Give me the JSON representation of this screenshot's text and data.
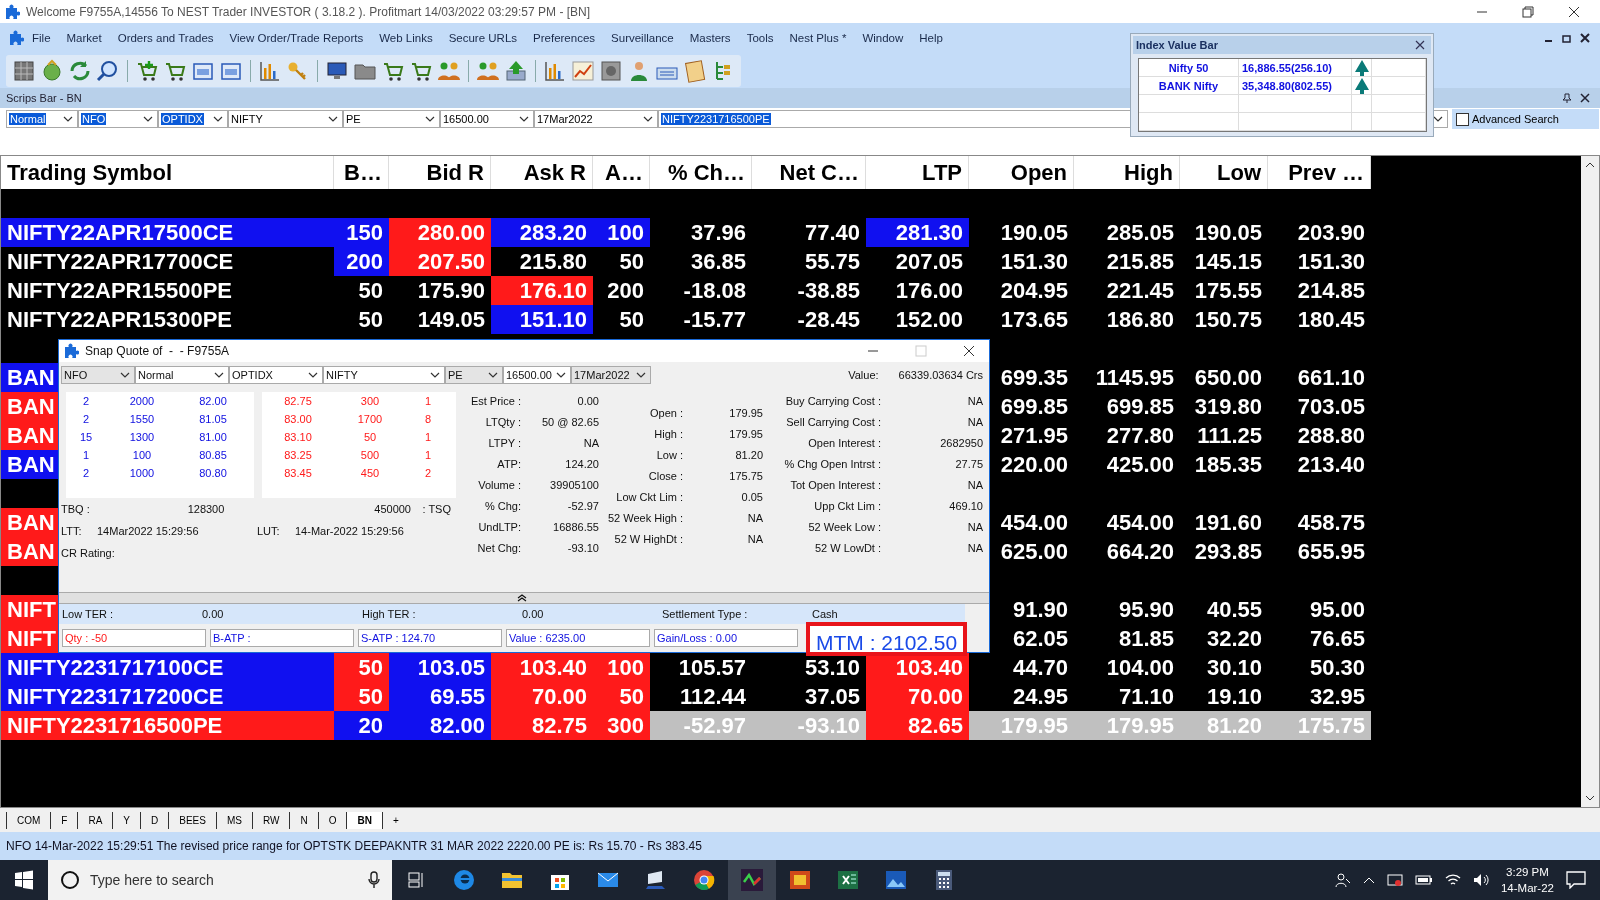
{
  "window": {
    "title": "Welcome F9755A,14556 To NEST Trader INVESTOR ( 3.18.2 ).  Profitmart  14/03/2022  03:29:57 PM - [BN]"
  },
  "menu": [
    "File",
    "Market",
    "Orders and Trades",
    "View Order/Trade Reports",
    "Web Links",
    "Secure URLs",
    "Preferences",
    "Surveillance",
    "Masters",
    "Tools",
    "Nest Plus *",
    "Window",
    "Help"
  ],
  "scrips_bar": {
    "title": "Scrips Bar - BN",
    "fields": [
      {
        "value": "Normal",
        "highlighted": true
      },
      {
        "value": "NFO",
        "highlighted": true
      },
      {
        "value": "OPTIDX",
        "highlighted": true
      },
      {
        "value": "NIFTY",
        "highlighted": false
      },
      {
        "value": "PE",
        "highlighted": false
      },
      {
        "value": "16500.00",
        "highlighted": false
      },
      {
        "value": "17Mar2022",
        "highlighted": false
      }
    ],
    "symbol": {
      "value": "NIFTY2231716500PE",
      "highlighted": true
    },
    "advanced_search": {
      "label": "Advanced Search",
      "checked": false
    }
  },
  "index_value_bar": {
    "title": "Index Value Bar",
    "rows": [
      {
        "name": "Nifty 50",
        "value": "16,886.55(256.10)",
        "rising": true
      },
      {
        "name": "BANK Nifty",
        "value": "35,348.80(802.55)",
        "rising": true
      }
    ]
  },
  "market_watch": {
    "columns": [
      "Trading Symbol",
      "B…",
      "Bid R",
      "Ask R",
      "A…",
      "% Ch…",
      "Net C…",
      "LTP",
      "Open",
      "High",
      "Low",
      "Prev …"
    ],
    "rows": [
      {
        "kind": "blank",
        "selected": false
      },
      {
        "kind": "quote",
        "selected": false,
        "symbol": {
          "text": "NIFTY22APR17500CE",
          "color": "#1010f0"
        },
        "cells": [
          {
            "text": "150",
            "color": "#1010f0"
          },
          {
            "text": "280.00",
            "color": "#ff1a1a"
          },
          {
            "text": "283.20",
            "color": "#1010f0"
          },
          {
            "text": "100",
            "color": "#1010f0"
          },
          {
            "text": "37.96"
          },
          {
            "text": "77.40"
          },
          {
            "text": "281.30",
            "color": "#1010f0"
          },
          {
            "text": "190.05"
          },
          {
            "text": "285.05"
          },
          {
            "text": "190.05"
          },
          {
            "text": "203.90"
          }
        ]
      },
      {
        "kind": "quote",
        "selected": false,
        "symbol": {
          "text": "NIFTY22APR17700CE"
        },
        "cells": [
          {
            "text": "200",
            "color": "#1010f0"
          },
          {
            "text": "207.50",
            "color": "#ff1a1a"
          },
          {
            "text": "215.80"
          },
          {
            "text": "50"
          },
          {
            "text": "36.85"
          },
          {
            "text": "55.75"
          },
          {
            "text": "207.05"
          },
          {
            "text": "151.30"
          },
          {
            "text": "215.85"
          },
          {
            "text": "145.15"
          },
          {
            "text": "151.30"
          }
        ]
      },
      {
        "kind": "quote",
        "selected": false,
        "symbol": {
          "text": "NIFTY22APR15500PE"
        },
        "cells": [
          {
            "text": "50"
          },
          {
            "text": "175.90"
          },
          {
            "text": "176.10",
            "color": "#ff1a1a"
          },
          {
            "text": "200"
          },
          {
            "text": "-18.08"
          },
          {
            "text": "-38.85"
          },
          {
            "text": "176.00"
          },
          {
            "text": "204.95"
          },
          {
            "text": "221.45"
          },
          {
            "text": "175.55"
          },
          {
            "text": "214.85"
          }
        ]
      },
      {
        "kind": "quote",
        "selected": false,
        "symbol": {
          "text": "NIFTY22APR15300PE"
        },
        "cells": [
          {
            "text": "50"
          },
          {
            "text": "149.05"
          },
          {
            "text": "151.10",
            "color": "#1010f0"
          },
          {
            "text": "50"
          },
          {
            "text": "-15.77"
          },
          {
            "text": "-28.45"
          },
          {
            "text": "152.00"
          },
          {
            "text": "173.65"
          },
          {
            "text": "186.80"
          },
          {
            "text": "150.75"
          },
          {
            "text": "180.45"
          }
        ]
      },
      {
        "kind": "blank",
        "selected": false
      },
      {
        "kind": "quote",
        "selected": false,
        "symbol": {
          "text": "BAN",
          "color": "#1010f0"
        },
        "cells": [
          {
            "text": "699.35"
          },
          {
            "text": "1145.95"
          },
          {
            "text": "650.00"
          },
          {
            "text": "661.10"
          }
        ]
      },
      {
        "kind": "quote",
        "selected": false,
        "symbol": {
          "text": "BAN",
          "color": "#ff1a1a"
        },
        "cells": [
          {
            "text": "699.85"
          },
          {
            "text": "699.85"
          },
          {
            "text": "319.80"
          },
          {
            "text": "703.05"
          }
        ]
      },
      {
        "kind": "quote",
        "selected": false,
        "symbol": {
          "text": "BAN",
          "color": "#ff1a1a"
        },
        "cells": [
          {
            "text": "271.95"
          },
          {
            "text": "277.80"
          },
          {
            "text": "111.25"
          },
          {
            "text": "288.80"
          }
        ]
      },
      {
        "kind": "quote",
        "selected": false,
        "symbol": {
          "text": "BAN",
          "color": "#1010f0"
        },
        "cells": [
          {
            "text": "220.00"
          },
          {
            "text": "425.00"
          },
          {
            "text": "185.35"
          },
          {
            "text": "213.40"
          }
        ]
      },
      {
        "kind": "blank",
        "selected": false
      },
      {
        "kind": "quote",
        "selected": false,
        "symbol": {
          "text": "BAN",
          "color": "#ff1a1a"
        },
        "cells": [
          {
            "text": "454.00"
          },
          {
            "text": "454.00"
          },
          {
            "text": "191.60"
          },
          {
            "text": "458.75"
          }
        ]
      },
      {
        "kind": "quote",
        "selected": false,
        "symbol": {
          "text": "BAN",
          "color": "#ff1a1a"
        },
        "cells": [
          {
            "text": "625.00"
          },
          {
            "text": "664.20"
          },
          {
            "text": "293.85"
          },
          {
            "text": "655.95"
          }
        ]
      },
      {
        "kind": "blank",
        "selected": false
      },
      {
        "kind": "quote",
        "selected": false,
        "symbol": {
          "text": "NIFT",
          "color": "#ff1a1a"
        },
        "cells": [
          {
            "text": "91.90"
          },
          {
            "text": "95.90"
          },
          {
            "text": "40.55"
          },
          {
            "text": "95.00"
          }
        ]
      },
      {
        "kind": "quote",
        "selected": false,
        "symbol": {
          "text": "NIFT",
          "color": "#ff1a1a"
        },
        "cells": [
          {
            "text": "62.05"
          },
          {
            "text": "81.85"
          },
          {
            "text": "32.20"
          },
          {
            "text": "76.65"
          }
        ]
      },
      {
        "kind": "quote",
        "selected": false,
        "symbol": {
          "text": "NIFTY2231717100CE",
          "color": "#1010f0"
        },
        "cells": [
          {
            "text": "50",
            "color": "#ff1a1a"
          },
          {
            "text": "103.05",
            "color": "#1010f0"
          },
          {
            "text": "103.40",
            "color": "#ff1a1a"
          },
          {
            "text": "100",
            "color": "#ff1a1a"
          },
          {
            "text": "105.57"
          },
          {
            "text": "53.10"
          },
          {
            "text": "103.40",
            "color": "#ff1a1a"
          },
          {
            "text": "44.70"
          },
          {
            "text": "104.00"
          },
          {
            "text": "30.10"
          },
          {
            "text": "50.30"
          }
        ]
      },
      {
        "kind": "quote",
        "selected": false,
        "symbol": {
          "text": "NIFTY2231717200CE",
          "color": "#1010f0"
        },
        "cells": [
          {
            "text": "50",
            "color": "#ff1a1a"
          },
          {
            "text": "69.55",
            "color": "#1010f0"
          },
          {
            "text": "70.00",
            "color": "#ff1a1a"
          },
          {
            "text": "50",
            "color": "#ff1a1a"
          },
          {
            "text": "112.44"
          },
          {
            "text": "37.05"
          },
          {
            "text": "70.00",
            "color": "#ff1a1a"
          },
          {
            "text": "24.95"
          },
          {
            "text": "71.10"
          },
          {
            "text": "19.10"
          },
          {
            "text": "32.95"
          }
        ]
      },
      {
        "kind": "quote",
        "selected": true,
        "symbol": {
          "text": "NIFTY2231716500PE",
          "color": "#ff1a1a"
        },
        "cells": [
          {
            "text": "20",
            "color": "#1010f0"
          },
          {
            "text": "82.00",
            "color": "#1010f0"
          },
          {
            "text": "82.75",
            "color": "#ff1a1a"
          },
          {
            "text": "300",
            "color": "#ff1a1a"
          },
          {
            "text": "-52.97"
          },
          {
            "text": "-93.10"
          },
          {
            "text": "82.65",
            "color": "#ff1a1a"
          },
          {
            "text": "179.95"
          },
          {
            "text": "179.95"
          },
          {
            "text": "81.20"
          },
          {
            "text": "175.75"
          }
        ]
      }
    ]
  },
  "snap_quote": {
    "title": "Snap Quote of  -  - F9755A",
    "selectors": [
      "NFO",
      "Normal",
      "OPTIDX",
      "NIFTY",
      "PE",
      "16500.00",
      "17Mar2022"
    ],
    "value": {
      "label": "Value:",
      "value": "66339.03634 Crs"
    },
    "bids": [
      [
        "2",
        "2000",
        "82.00"
      ],
      [
        "2",
        "1550",
        "81.05"
      ],
      [
        "15",
        "1300",
        "81.00"
      ],
      [
        "1",
        "100",
        "80.85"
      ],
      [
        "2",
        "1000",
        "80.80"
      ]
    ],
    "asks": [
      [
        "82.75",
        "300",
        "1"
      ],
      [
        "83.00",
        "1700",
        "8"
      ],
      [
        "83.10",
        "50",
        "1"
      ],
      [
        "83.25",
        "500",
        "1"
      ],
      [
        "83.45",
        "450",
        "2"
      ]
    ],
    "tbq": {
      "label": "TBQ :",
      "value": "128300"
    },
    "tsq": {
      "label": ": TSQ",
      "value": "450000"
    },
    "ltt": {
      "label": "LTT:",
      "value": "14Mar2022 15:29:56"
    },
    "lut": {
      "label": "LUT:",
      "value": "14-Mar-2022 15:29:56"
    },
    "cr_rating": "CR Rating:",
    "details": [
      [
        {
          "label": "Est Price :",
          "value": "0.00"
        },
        {
          "label": "LTQty :",
          "value": "50 @ 82.65"
        },
        {
          "label": "LTPY :",
          "value": "NA"
        },
        {
          "label": "ATP:",
          "value": "124.20"
        },
        {
          "label": "Volume :",
          "value": "39905100"
        },
        {
          "label": "% Chg:",
          "value": "-52.97"
        },
        {
          "label": "UndLTP:",
          "value": "16886.55"
        },
        {
          "label": "Net Chg:",
          "value": "-93.10"
        }
      ],
      [
        {
          "label": "Open :",
          "value": "179.95"
        },
        {
          "label": "High :",
          "value": "179.95"
        },
        {
          "label": "Low :",
          "value": "81.20"
        },
        {
          "label": "Close :",
          "value": "175.75"
        },
        {
          "label": "Low Ckt Lim :",
          "value": "0.05"
        },
        {
          "label": "52 Week High :",
          "value": "NA"
        },
        {
          "label": "52 W HighDt :",
          "value": "NA"
        }
      ],
      [
        {
          "label": "Buy Carrying Cost :",
          "value": "NA"
        },
        {
          "label": "Sell Carrying Cost :",
          "value": "NA"
        },
        {
          "label": "Open Interest :",
          "value": "2682950"
        },
        {
          "label": "% Chg Open Intrst :",
          "value": "27.75"
        },
        {
          "label": "Tot Open Interest :",
          "value": "NA"
        },
        {
          "label": "Upp Ckt Lim :",
          "value": "469.10"
        },
        {
          "label": "52 Week Low :",
          "value": "NA"
        },
        {
          "label": "52 W LowDt :",
          "value": "NA"
        }
      ]
    ],
    "ter_bar": [
      {
        "label": "Low TER :",
        "value": "0.00"
      },
      {
        "label": "High TER :",
        "value": "0.00"
      },
      {
        "label": "Settlement Type :",
        "value": "Cash"
      }
    ],
    "summary": [
      {
        "text": "Qty : -50",
        "kind": "alert"
      },
      {
        "text": "B-ATP :",
        "kind": "normal"
      },
      {
        "text": "S-ATP : 124.70",
        "kind": "normal"
      },
      {
        "text": "Value : 6235.00",
        "kind": "normal"
      },
      {
        "text": "Gain/Loss : 0.00",
        "kind": "normal"
      }
    ],
    "mtm": "MTM : 2102.50"
  },
  "sheet_tabs": [
    {
      "label": "COM",
      "selected": false
    },
    {
      "label": "F",
      "selected": false
    },
    {
      "label": "RA",
      "selected": false
    },
    {
      "label": "Y",
      "selected": false
    },
    {
      "label": "D",
      "selected": false
    },
    {
      "label": "BEES",
      "selected": false
    },
    {
      "label": "MS",
      "selected": false
    },
    {
      "label": "RW",
      "selected": false
    },
    {
      "label": "N",
      "selected": false
    },
    {
      "label": "O",
      "selected": false
    },
    {
      "label": "BN",
      "selected": true
    },
    {
      "label": "+",
      "selected": false
    }
  ],
  "status_bar": "NFO 14-Mar-2022 15:29:51 The revised price range for OPTSTK DEEPAKNTR 31 MAR 2022 2220.00 PE is: Rs 15.70 - Rs 383.45",
  "taskbar": {
    "search_placeholder": "Type here to search",
    "time": "3:29 PM",
    "date": "14-Mar-22"
  }
}
